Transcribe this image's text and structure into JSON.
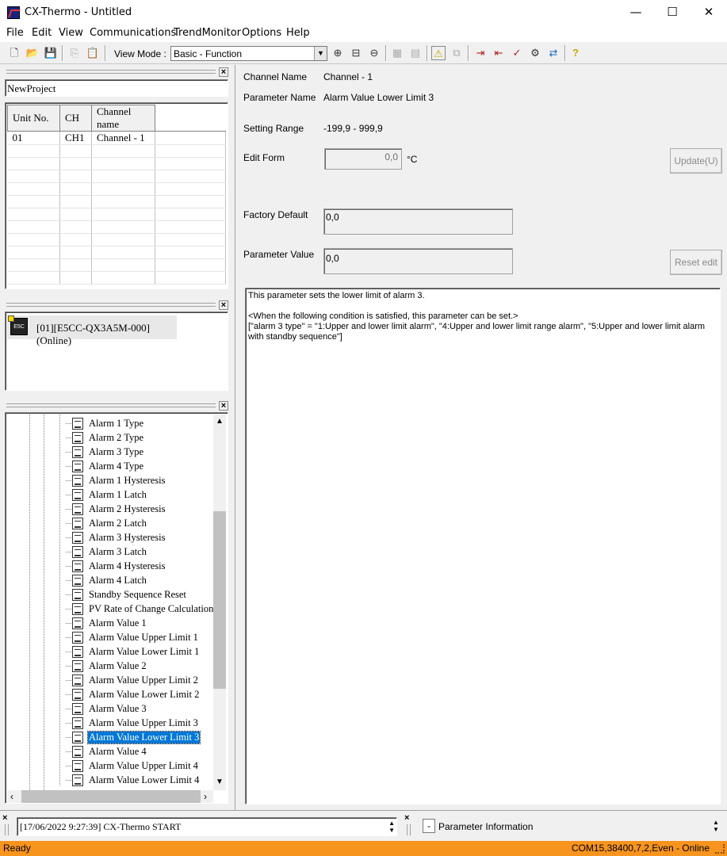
{
  "window": {
    "title": "CX-Thermo - Untitled",
    "minimize": "—",
    "maximize": "☐",
    "close": "✕"
  },
  "menu": [
    "File",
    "Edit",
    "View",
    "Communications",
    "TrendMonitor",
    "Options",
    "Help"
  ],
  "toolbar": {
    "view_mode_label": "View Mode :",
    "view_mode_value": "Basic - Function"
  },
  "project_panel": {
    "project_name": "NewProject"
  },
  "unit_grid": {
    "headers": [
      "Unit No.",
      "CH",
      "Channel name"
    ],
    "rows": [
      [
        "01",
        "CH1",
        "Channel - 1"
      ]
    ]
  },
  "device_panel": {
    "device_label": "[01][E5CC-QX3A5M-000](Online)",
    "device_icon_text": "E5C"
  },
  "parameter_tree": {
    "items": [
      "Alarm 1 Type",
      "Alarm 2 Type",
      "Alarm 3 Type",
      "Alarm 4 Type",
      "Alarm 1 Hysteresis",
      "Alarm 1 Latch",
      "Alarm 2 Hysteresis",
      "Alarm 2 Latch",
      "Alarm 3 Hysteresis",
      "Alarm 3 Latch",
      "Alarm 4 Hysteresis",
      "Alarm 4 Latch",
      "Standby Sequence Reset",
      "PV Rate of Change Calculation Pe",
      "Alarm Value 1",
      "Alarm Value Upper Limit 1",
      "Alarm Value Lower Limit 1",
      "Alarm Value 2",
      "Alarm Value Upper Limit 2",
      "Alarm Value Lower Limit 2",
      "Alarm Value 3",
      "Alarm Value Upper Limit 3",
      "Alarm Value Lower Limit 3",
      "Alarm Value 4",
      "Alarm Value Upper Limit 4",
      "Alarm Value Lower Limit 4"
    ],
    "selected": "Alarm Value Lower Limit 3"
  },
  "detail": {
    "channel_name_label": "Channel Name",
    "channel_name_value": "Channel - 1",
    "param_name_label": "Parameter Name",
    "param_name_value": "Alarm Value Lower Limit 3",
    "setting_range_label": "Setting Range",
    "setting_range_value": "-199,9 - 999,9",
    "edit_form_label": "Edit Form",
    "edit_form_value": "0,0",
    "unit": "°C",
    "update_button": "Update(U)",
    "factory_default_label": "Factory Default",
    "factory_default_value": "0,0",
    "parameter_value_label": "Parameter Value",
    "parameter_value_value": "0,0",
    "reset_button": "Reset edit",
    "description_line1": "This parameter sets the lower limit of alarm 3.",
    "description_line2": "<When the following condition is satisfied, this parameter can be set.>",
    "description_line3": "[\"alarm 3 type\" = \"1:Upper and lower limit alarm\", \"4:Upper and lower limit range alarm\", \"5:Upper and lower limit alarm with standby sequence\"]"
  },
  "log": {
    "entry": "[17/06/2022 9:27:39] CX-Thermo START"
  },
  "info_panel": {
    "toggle": "-",
    "title": "Parameter Information"
  },
  "status": {
    "left": "Ready",
    "right": "COM15,38400,7,2,Even - Online"
  }
}
